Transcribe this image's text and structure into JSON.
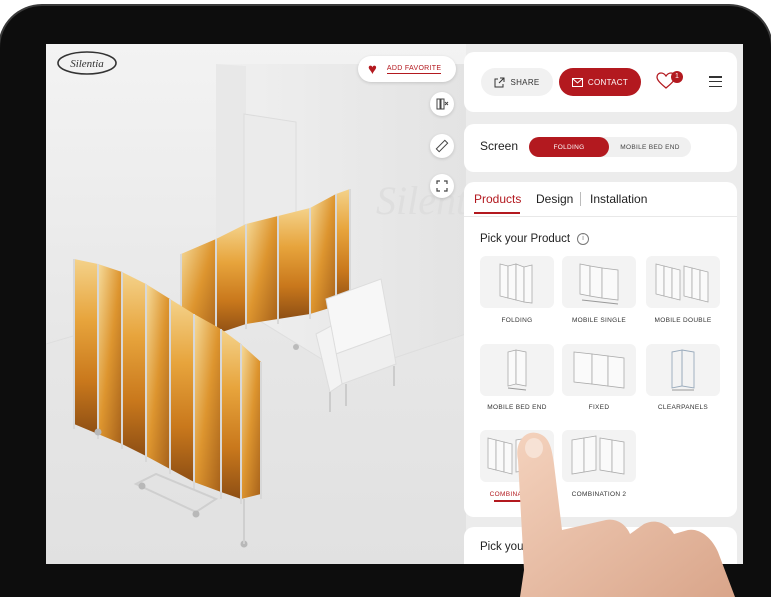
{
  "brand": {
    "logo_text": "Silentia"
  },
  "viewer": {
    "add_favorite_label": "ADD FAVORITE",
    "tools": [
      {
        "name": "view-mode-icon"
      },
      {
        "name": "measure-icon"
      },
      {
        "name": "fullscreen-icon"
      }
    ]
  },
  "header": {
    "share_label": "SHARE",
    "contact_label": "CONTACT",
    "favorites_count": "1"
  },
  "screen_selector": {
    "label": "Screen",
    "options": [
      "FOLDING",
      "MOBILE BED END"
    ],
    "selected": "FOLDING"
  },
  "tabs": [
    "Products",
    "Design",
    "Installation"
  ],
  "active_tab": "Products",
  "product_section": {
    "title": "Pick your Product",
    "products": [
      {
        "label": "FOLDING"
      },
      {
        "label": "MOBILE SINGLE"
      },
      {
        "label": "MOBILE DOUBLE"
      },
      {
        "label": "MOBILE BED END"
      },
      {
        "label": "FIXED"
      },
      {
        "label": "CLEARPANELS"
      },
      {
        "label": "COMBINATION 1"
      },
      {
        "label": "COMBINATION 2"
      }
    ],
    "selected": "COMBINATION 1"
  },
  "next_section": {
    "title": "Pick your"
  },
  "colors": {
    "accent": "#b3191f",
    "panel_bg": "#ececec",
    "card_bg": "#ffffff"
  }
}
